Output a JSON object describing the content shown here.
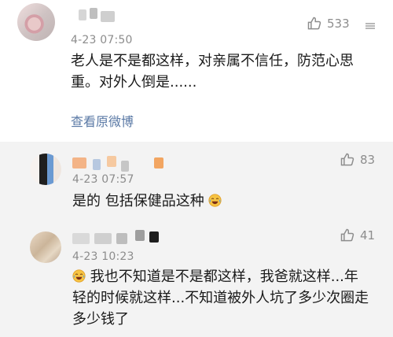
{
  "comments": [
    {
      "time": "4-23 07:50",
      "likes": "533",
      "text_line1": "老人是不是都这样，对亲属不信任，防范心思",
      "text_line2": "重。对外人倒是......",
      "link": "查看原微博"
    },
    {
      "time": "4-23 07:57",
      "likes": "83",
      "text": "是的 包括保健品这种"
    },
    {
      "time": "4-23 10:23",
      "likes": "41",
      "text_line1": "我也不知道是不是都这样，我爸就这样...年",
      "text_line2": "轻的时候就这样...不知道被外人坑了多少次圈走",
      "text_line3": "多少钱了"
    }
  ],
  "icons": {
    "like": "thumbs-up-icon",
    "emoji": "laughing-face-icon"
  }
}
